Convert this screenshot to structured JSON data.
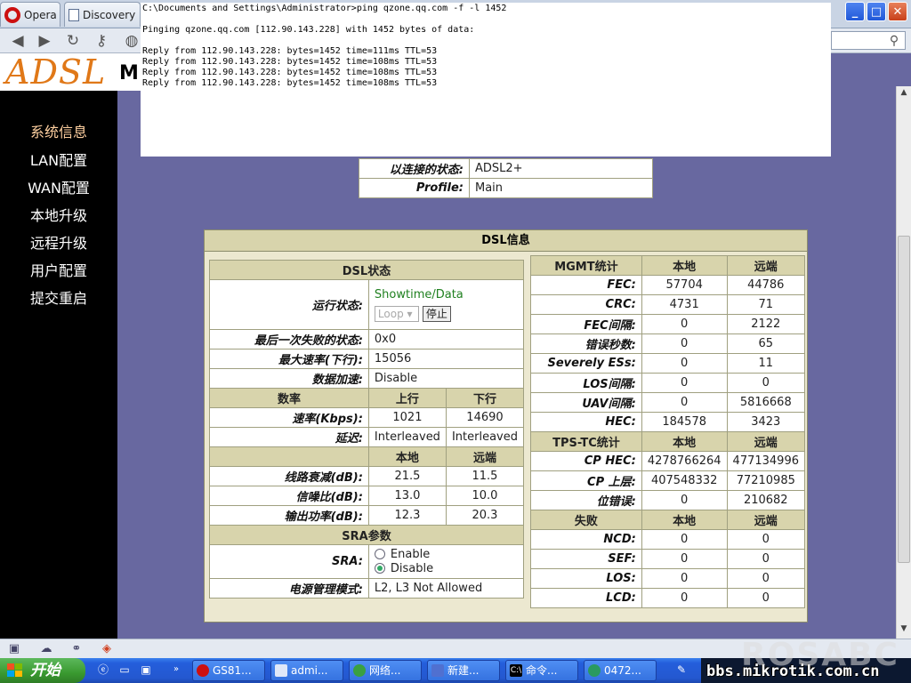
{
  "browser": {
    "tabs": [
      {
        "label": "Opera"
      },
      {
        "label": "Discovery"
      }
    ],
    "window_buttons": {
      "minimize": "_",
      "maximize": "□",
      "close": "✕"
    }
  },
  "router": {
    "logo": "ADSL",
    "header_letter": "M",
    "menu": [
      "系统信息",
      "LAN配置",
      "WAN配置",
      "本地升级",
      "远程升级",
      "用户配置",
      "提交重启"
    ],
    "connection": [
      {
        "label": "以连接的状态:",
        "value": "ADSL2+"
      },
      {
        "label": "Profile:",
        "value": "Main"
      }
    ],
    "dsl_title": "DSL信息",
    "dsl_status": {
      "title": "DSL状态",
      "run_state_label": "运行状态:",
      "run_state_value": "Showtime/Data",
      "loop_option": "Loop",
      "stop_button": "停止",
      "last_fail_label": "最后一次失败的状态:",
      "last_fail_value": "0x0",
      "max_rate_label": "最大速率(下行):",
      "max_rate_value": "15056",
      "data_accel_label": "数据加速:",
      "data_accel_value": "Disable"
    },
    "rate_table": {
      "headers": [
        "数率",
        "上行",
        "下行"
      ],
      "rows": [
        {
          "label": "速率(Kbps):",
          "up": "1021",
          "down": "14690"
        },
        {
          "label": "延迟:",
          "up": "Interleaved",
          "down": "Interleaved"
        }
      ]
    },
    "line_table": {
      "headers": [
        "本地",
        "远端"
      ],
      "rows": [
        {
          "label": "线路衰减(dB):",
          "local": "21.5",
          "remote": "11.5"
        },
        {
          "label": "信噪比(dB):",
          "local": "13.0",
          "remote": "10.0"
        },
        {
          "label": "输出功率(dB):",
          "local": "12.3",
          "remote": "20.3"
        }
      ]
    },
    "sra": {
      "title": "SRA参数",
      "label": "SRA:",
      "options": [
        "Enable",
        "Disable"
      ],
      "selected": "Disable",
      "power_label": "电源管理模式:",
      "power_value": "L2, L3 Not Allowed"
    },
    "mgmt": {
      "headers": [
        "MGMT统计",
        "本地",
        "远端"
      ],
      "rows": [
        {
          "label": "FEC:",
          "local": "57704",
          "remote": "44786"
        },
        {
          "label": "CRC:",
          "local": "4731",
          "remote": "71"
        },
        {
          "label": "FEC间隔:",
          "local": "0",
          "remote": "2122"
        },
        {
          "label": "错误秒数:",
          "local": "0",
          "remote": "65"
        },
        {
          "label": "Severely ESs:",
          "local": "0",
          "remote": "11"
        },
        {
          "label": "LOS间隔:",
          "local": "0",
          "remote": "0"
        },
        {
          "label": "UAV间隔:",
          "local": "0",
          "remote": "5816668"
        },
        {
          "label": "HEC:",
          "local": "184578",
          "remote": "3423"
        }
      ]
    },
    "tpstc": {
      "headers": [
        "TPS-TC统计",
        "本地",
        "远端"
      ],
      "rows": [
        {
          "label": "CP HEC:",
          "local": "4278766264",
          "remote": "477134996"
        },
        {
          "label": "CP 上层:",
          "local": "407548332",
          "remote": "77210985"
        },
        {
          "label": "位错误:",
          "local": "0",
          "remote": "210682"
        }
      ]
    },
    "failures": {
      "headers": [
        "失败",
        "本地",
        "远端"
      ],
      "rows": [
        {
          "label": "NCD:",
          "local": "0",
          "remote": "0"
        },
        {
          "label": "SEF:",
          "local": "0",
          "remote": "0"
        },
        {
          "label": "LOS:",
          "local": "0",
          "remote": "0"
        },
        {
          "label": "LCD:",
          "local": "0",
          "remote": "0"
        }
      ]
    }
  },
  "console": {
    "lines": [
      "C:\\Documents and Settings\\Administrator>ping qzone.qq.com -f -l 1452",
      "",
      "Pinging qzone.qq.com [112.90.143.228] with 1452 bytes of data:",
      "",
      "Reply from 112.90.143.228: bytes=1452 time=111ms TTL=53",
      "Reply from 112.90.143.228: bytes=1452 time=108ms TTL=53",
      "Reply from 112.90.143.228: bytes=1452 time=108ms TTL=53",
      "Reply from 112.90.143.228: bytes=1452 time=108ms TTL=53"
    ]
  },
  "taskbar": {
    "start_label": "开始",
    "items": [
      {
        "label": "GS81...",
        "icon": "opera-icon",
        "color": "#cc1010"
      },
      {
        "label": "admi...",
        "icon": "window-icon",
        "color": "#e0e8f8"
      },
      {
        "label": "网络...",
        "icon": "network-icon",
        "color": "#3aa040"
      },
      {
        "label": "新建...",
        "icon": "document-icon",
        "color": "#5070d0"
      },
      {
        "label": "命令...",
        "icon": "cmd-icon",
        "color": "#000000"
      },
      {
        "label": "0472...",
        "icon": "globe-icon",
        "color": "#2a9a60"
      }
    ],
    "tray_watermark": "bbs.mikrotik.com.cn"
  },
  "watermark": "ROSABC"
}
